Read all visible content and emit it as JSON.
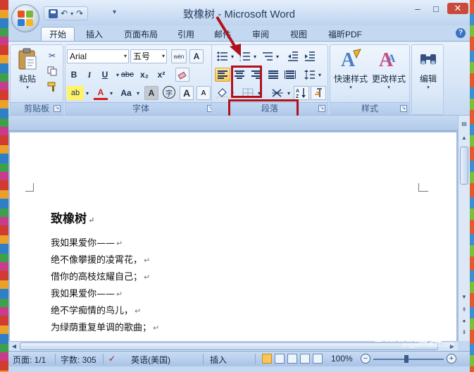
{
  "window": {
    "title": "致橡树 - Microsoft Word",
    "controls": {
      "minimize": "–",
      "maximize": "□",
      "close": "✕"
    }
  },
  "quick_access": {
    "undo": "↶",
    "redo": "↷",
    "more": "▾"
  },
  "tabs": [
    {
      "label": "开始",
      "active": true
    },
    {
      "label": "插入"
    },
    {
      "label": "页面布局"
    },
    {
      "label": "引用"
    },
    {
      "label": "邮件"
    },
    {
      "label": "审阅"
    },
    {
      "label": "视图"
    },
    {
      "label": "福昕PDF"
    }
  ],
  "help": "?",
  "ribbon": {
    "clipboard": {
      "group_label": "剪贴板",
      "paste_label": "粘贴"
    },
    "font": {
      "group_label": "字体",
      "font_name": "Arial",
      "font_size": "五号",
      "bold": "B",
      "italic": "I",
      "underline": "U",
      "strike": "abe",
      "subscript": "x₂",
      "superscript": "x²",
      "highlight": "ab",
      "color": "A",
      "change_case": "Aa",
      "char_shading": "A",
      "enclose": "字",
      "grow": "A",
      "shrink": "A",
      "phonetic": "wén",
      "border": "A"
    },
    "paragraph": {
      "group_label": "段落"
    },
    "styles": {
      "group_label": "样式",
      "quick_styles": "快速样式",
      "change_styles": "更改样式"
    },
    "editing": {
      "label": "编辑"
    }
  },
  "document": {
    "title": "致橡树",
    "lines": [
      "我如果爱你——",
      "绝不像攀援的凌霄花，",
      "借你的高枝炫耀自己；",
      "我如果爱你——",
      "绝不学痴情的鸟儿，",
      "为绿荫重复单调的歌曲；"
    ],
    "paragraph_mark": "↵"
  },
  "statusbar": {
    "page": "页面: 1/1",
    "words": "字数: 305",
    "language": "英语(美国)",
    "mode": "插入",
    "zoom": "100%"
  },
  "watermark": {
    "text": "Baidu经验",
    "sub": "jingyan.baidu.com"
  },
  "colors": {
    "annotation": "#b0121b",
    "selected_button": "#f8c756",
    "ribbon": "#dce9f9"
  }
}
